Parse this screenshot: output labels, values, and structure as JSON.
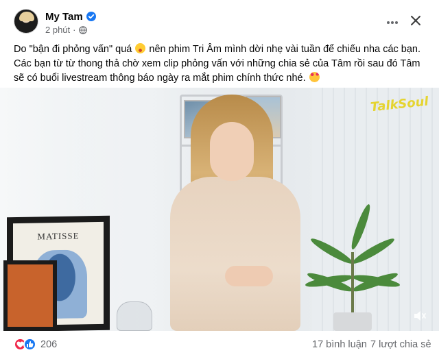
{
  "header": {
    "author_name": "My Tam",
    "time_ago": "2 phút",
    "meta_separator": "·",
    "verified": true,
    "privacy_icon": "globe-icon",
    "more_icon": "more-horizontal-icon",
    "close_icon": "close-icon"
  },
  "caption": {
    "line1_before": "Do \"bận đi phỏng vấn\" quá",
    "line1_after": "nên phim Tri Âm mình dời nhẹ vài tuần để chiếu nha các bạn. Các bạn từ từ thong thả chờ xem clip phỏng vấn với những chia sẻ của Tâm rồi sau đó Tâm sẽ có buổi livestream thông báo ngày ra mắt phim chính thức nhé.",
    "emoji_1": "grinning-face-icon",
    "emoji_2": "smiling-face-with-hearts-icon"
  },
  "photo": {
    "poster_text": "MATISSE",
    "watermark_text": "TalkSoul",
    "volume_icon": "speaker-icon"
  },
  "footer": {
    "reaction_icons": [
      "love-reaction-icon",
      "like-reaction-icon"
    ],
    "reaction_count": "206",
    "comments_label": "17 bình luận",
    "shares_label": "7 lượt chia sẻ"
  },
  "colors": {
    "brand_blue": "#1877f2",
    "love_red": "#f0284a",
    "secondary_text": "#65676b",
    "primary_text": "#050505"
  }
}
